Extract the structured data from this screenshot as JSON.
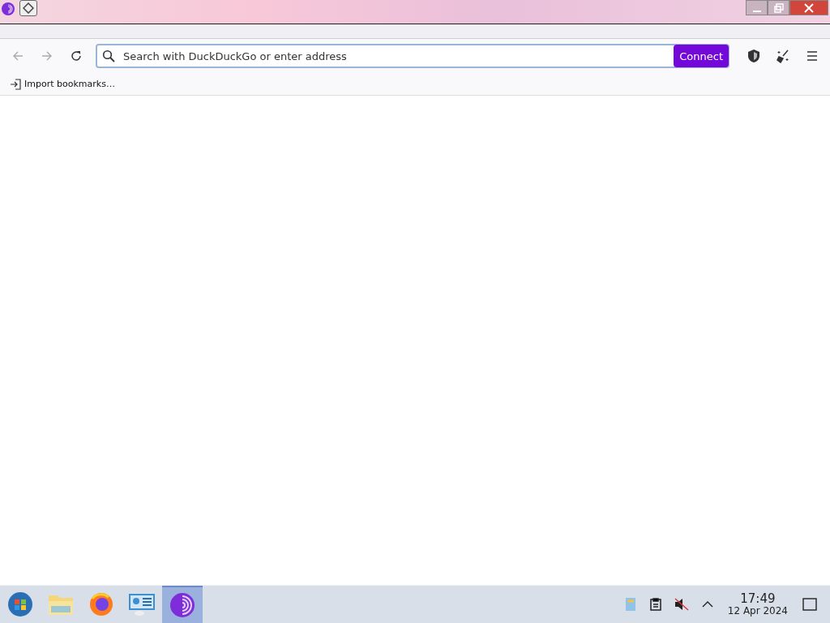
{
  "toolbar": {
    "back": {
      "disabled": true
    },
    "forward": {
      "disabled": true
    },
    "address": {
      "placeholder": "Search with DuckDuckGo or enter address"
    },
    "connect_button": "Connect"
  },
  "bookmarks_bar": {
    "import_label": "Import bookmarks…"
  },
  "taskbar": {
    "apps": [
      {
        "kind": "start",
        "selected": false
      },
      {
        "kind": "folder",
        "selected": false
      },
      {
        "kind": "firefox",
        "selected": false
      },
      {
        "kind": "network",
        "selected": false
      },
      {
        "kind": "tor",
        "selected": true
      }
    ],
    "clock": {
      "time": "17:49",
      "date": "12 Apr 2024"
    }
  }
}
